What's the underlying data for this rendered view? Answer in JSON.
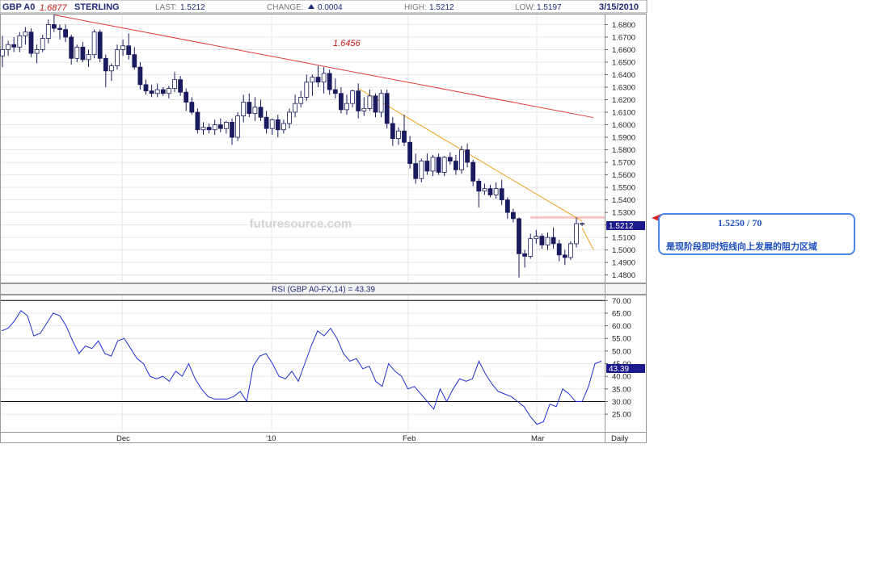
{
  "header": {
    "symbol": "GBP A0",
    "name": "STERLING",
    "last_label": "LAST:",
    "last_value": "1.5212",
    "change_label": "CHANGE:",
    "change_value": "0.0004",
    "high_label": "HIGH:",
    "high_value": "1.5212",
    "low_label": "LOW:",
    "low_value": "1.5197",
    "date": "3/15/2010"
  },
  "annotations": {
    "high_mark": "1.6877",
    "peak_mark": "1.6456",
    "last_price_tag": "1.5212",
    "watermark": "futuresource.com"
  },
  "callout": {
    "level": "1.5250 / 70",
    "note": "是现阶段即时短线向上发展的阻力区域"
  },
  "colors": {
    "bull_candle": "#ffffff",
    "bear_candle": "#1a1a5e",
    "red_trendline": "#e03a3a",
    "orange_trendline": "#f0a020",
    "rsi_line": "#1f2fd0",
    "resistance_zone": "#f4b0b0",
    "callout_border": "#4a86e8",
    "callout_text": "#1f4fbf"
  },
  "chart_data": [
    {
      "type": "candlestick",
      "series_name": "GBP A0 STERLING Daily",
      "x_tick_labels": [
        "Dec",
        "'10",
        "Feb",
        "Mar"
      ],
      "period_label": "Daily",
      "y_tick_labels": [
        "1.6800",
        "1.6700",
        "1.6600",
        "1.6500",
        "1.6400",
        "1.6300",
        "1.6200",
        "1.6100",
        "1.6000",
        "1.5900",
        "1.5800",
        "1.5700",
        "1.5600",
        "1.5500",
        "1.5400",
        "1.5300",
        "1.5200",
        "1.5100",
        "1.5000",
        "1.4900",
        "1.4800"
      ],
      "ylim": [
        1.474,
        1.688
      ],
      "candles": [
        [
          1.655,
          1.671,
          1.646,
          1.66
        ],
        [
          1.66,
          1.667,
          1.655,
          1.664
        ],
        [
          1.664,
          1.67,
          1.658,
          1.662
        ],
        [
          1.662,
          1.674,
          1.658,
          1.671
        ],
        [
          1.671,
          1.678,
          1.664,
          1.674
        ],
        [
          1.674,
          1.677,
          1.654,
          1.657
        ],
        [
          1.657,
          1.664,
          1.649,
          1.66
        ],
        [
          1.66,
          1.672,
          1.658,
          1.669
        ],
        [
          1.669,
          1.684,
          1.665,
          1.68
        ],
        [
          1.68,
          1.688,
          1.674,
          1.677
        ],
        [
          1.677,
          1.68,
          1.668,
          1.676
        ],
        [
          1.676,
          1.68,
          1.666,
          1.67
        ],
        [
          1.67,
          1.672,
          1.648,
          1.653
        ],
        [
          1.653,
          1.664,
          1.65,
          1.662
        ],
        [
          1.662,
          1.666,
          1.65,
          1.652
        ],
        [
          1.652,
          1.66,
          1.646,
          1.656
        ],
        [
          1.656,
          1.676,
          1.653,
          1.674
        ],
        [
          1.674,
          1.676,
          1.65,
          1.653
        ],
        [
          1.653,
          1.656,
          1.63,
          1.643
        ],
        [
          1.643,
          1.649,
          1.635,
          1.647
        ],
        [
          1.647,
          1.664,
          1.644,
          1.66
        ],
        [
          1.66,
          1.668,
          1.655,
          1.663
        ],
        [
          1.663,
          1.673,
          1.652,
          1.656
        ],
        [
          1.656,
          1.662,
          1.644,
          1.646
        ],
        [
          1.646,
          1.65,
          1.628,
          1.632
        ],
        [
          1.632,
          1.636,
          1.624,
          1.627
        ],
        [
          1.627,
          1.632,
          1.622,
          1.625
        ],
        [
          1.625,
          1.633,
          1.622,
          1.628
        ],
        [
          1.628,
          1.63,
          1.623,
          1.625
        ],
        [
          1.625,
          1.631,
          1.621,
          1.629
        ],
        [
          1.629,
          1.642,
          1.626,
          1.636
        ],
        [
          1.636,
          1.639,
          1.623,
          1.626
        ],
        [
          1.626,
          1.629,
          1.611,
          1.618
        ],
        [
          1.618,
          1.622,
          1.608,
          1.61
        ],
        [
          1.61,
          1.613,
          1.593,
          1.596
        ],
        [
          1.596,
          1.602,
          1.592,
          1.598
        ],
        [
          1.598,
          1.601,
          1.593,
          1.596
        ],
        [
          1.596,
          1.604,
          1.592,
          1.6
        ],
        [
          1.6,
          1.605,
          1.594,
          1.597
        ],
        [
          1.597,
          1.603,
          1.593,
          1.602
        ],
        [
          1.602,
          1.605,
          1.584,
          1.59
        ],
        [
          1.59,
          1.61,
          1.587,
          1.607
        ],
        [
          1.607,
          1.624,
          1.602,
          1.618
        ],
        [
          1.618,
          1.625,
          1.606,
          1.609
        ],
        [
          1.609,
          1.622,
          1.603,
          1.614
        ],
        [
          1.614,
          1.62,
          1.603,
          1.606
        ],
        [
          1.606,
          1.611,
          1.593,
          1.597
        ],
        [
          1.597,
          1.605,
          1.592,
          1.604
        ],
        [
          1.604,
          1.608,
          1.59,
          1.596
        ],
        [
          1.596,
          1.604,
          1.593,
          1.601
        ],
        [
          1.601,
          1.613,
          1.597,
          1.61
        ],
        [
          1.61,
          1.624,
          1.606,
          1.617
        ],
        [
          1.617,
          1.627,
          1.614,
          1.622
        ],
        [
          1.622,
          1.64,
          1.619,
          1.634
        ],
        [
          1.634,
          1.64,
          1.623,
          1.638
        ],
        [
          1.638,
          1.647,
          1.63,
          1.634
        ],
        [
          1.634,
          1.646,
          1.625,
          1.641
        ],
        [
          1.641,
          1.644,
          1.624,
          1.628
        ],
        [
          1.628,
          1.637,
          1.621,
          1.625
        ],
        [
          1.625,
          1.63,
          1.609,
          1.612
        ],
        [
          1.612,
          1.624,
          1.608,
          1.617
        ],
        [
          1.617,
          1.628,
          1.614,
          1.627
        ],
        [
          1.627,
          1.633,
          1.605,
          1.611
        ],
        [
          1.611,
          1.622,
          1.607,
          1.613
        ],
        [
          1.613,
          1.628,
          1.611,
          1.623
        ],
        [
          1.623,
          1.625,
          1.606,
          1.61
        ],
        [
          1.61,
          1.628,
          1.606,
          1.625
        ],
        [
          1.625,
          1.628,
          1.597,
          1.601
        ],
        [
          1.601,
          1.606,
          1.583,
          1.589
        ],
        [
          1.589,
          1.598,
          1.584,
          1.595
        ],
        [
          1.595,
          1.608,
          1.583,
          1.586
        ],
        [
          1.586,
          1.591,
          1.565,
          1.569
        ],
        [
          1.569,
          1.577,
          1.553,
          1.557
        ],
        [
          1.557,
          1.573,
          1.554,
          1.571
        ],
        [
          1.571,
          1.577,
          1.56,
          1.563
        ],
        [
          1.563,
          1.576,
          1.559,
          1.574
        ],
        [
          1.574,
          1.577,
          1.56,
          1.562
        ],
        [
          1.562,
          1.575,
          1.559,
          1.574
        ],
        [
          1.574,
          1.578,
          1.568,
          1.571
        ],
        [
          1.571,
          1.576,
          1.56,
          1.564
        ],
        [
          1.564,
          1.583,
          1.561,
          1.58
        ],
        [
          1.58,
          1.585,
          1.566,
          1.57
        ],
        [
          1.57,
          1.572,
          1.551,
          1.555
        ],
        [
          1.555,
          1.557,
          1.534,
          1.547
        ],
        [
          1.547,
          1.553,
          1.544,
          1.549
        ],
        [
          1.549,
          1.552,
          1.542,
          1.544
        ],
        [
          1.544,
          1.554,
          1.541,
          1.549
        ],
        [
          1.549,
          1.556,
          1.536,
          1.54
        ],
        [
          1.54,
          1.542,
          1.525,
          1.53
        ],
        [
          1.53,
          1.533,
          1.522,
          1.525
        ],
        [
          1.525,
          1.526,
          1.478,
          1.497
        ],
        [
          1.497,
          1.5,
          1.486,
          1.495
        ],
        [
          1.495,
          1.513,
          1.493,
          1.509
        ],
        [
          1.509,
          1.516,
          1.505,
          1.511
        ],
        [
          1.511,
          1.513,
          1.501,
          1.504
        ],
        [
          1.504,
          1.514,
          1.5,
          1.51
        ],
        [
          1.51,
          1.518,
          1.501,
          1.505
        ],
        [
          1.505,
          1.508,
          1.491,
          1.496
        ],
        [
          1.496,
          1.5,
          1.488,
          1.494
        ],
        [
          1.494,
          1.507,
          1.492,
          1.505
        ],
        [
          1.505,
          1.526,
          1.502,
          1.521
        ],
        [
          1.521,
          1.522,
          1.519,
          1.5212
        ]
      ],
      "trendlines": [
        {
          "color": "red",
          "from": {
            "bar": 9,
            "price": 1.6877
          },
          "to": {
            "bar": 103,
            "price": 1.6057
          }
        },
        {
          "color": "orange",
          "from": {
            "bar": 62,
            "price": 1.629
          },
          "to": {
            "bar": 101,
            "price": 1.523
          }
        },
        {
          "color": "orange",
          "from": {
            "bar": 101,
            "price": 1.5175
          },
          "to": {
            "bar": 103,
            "price": 1.5
          }
        }
      ],
      "resistance_zone": [
        1.525,
        1.527
      ]
    },
    {
      "type": "line",
      "title": "RSI (GBP A0-FX,14) = 43.39",
      "y_tick_labels": [
        "70.00",
        "65.00",
        "60.00",
        "55.00",
        "50.00",
        "45.00",
        "40.00",
        "35.00",
        "30.00",
        "25.00"
      ],
      "ylim": [
        18,
        72
      ],
      "reference_lines": [
        70,
        30
      ],
      "current_value": "43.39",
      "values": [
        58,
        59,
        62,
        66,
        64,
        56,
        57,
        61,
        65,
        64,
        60,
        54,
        49,
        52,
        51,
        54,
        49,
        48,
        54,
        55,
        51,
        47,
        45,
        40,
        39,
        40,
        38,
        42,
        40,
        45,
        39,
        35,
        32,
        31,
        31,
        31,
        32,
        34,
        30,
        44,
        48,
        49,
        45,
        40,
        39,
        42,
        38,
        45,
        52,
        58,
        56,
        59,
        55,
        49,
        46,
        47,
        43,
        44,
        38,
        36,
        45,
        42,
        40,
        35,
        36,
        33,
        30,
        27,
        35,
        30,
        35,
        39,
        38,
        39,
        46,
        41,
        37,
        34,
        33,
        32,
        30,
        28,
        24,
        21,
        22,
        29,
        28,
        35,
        33,
        30,
        30,
        36,
        45,
        46
      ]
    }
  ]
}
